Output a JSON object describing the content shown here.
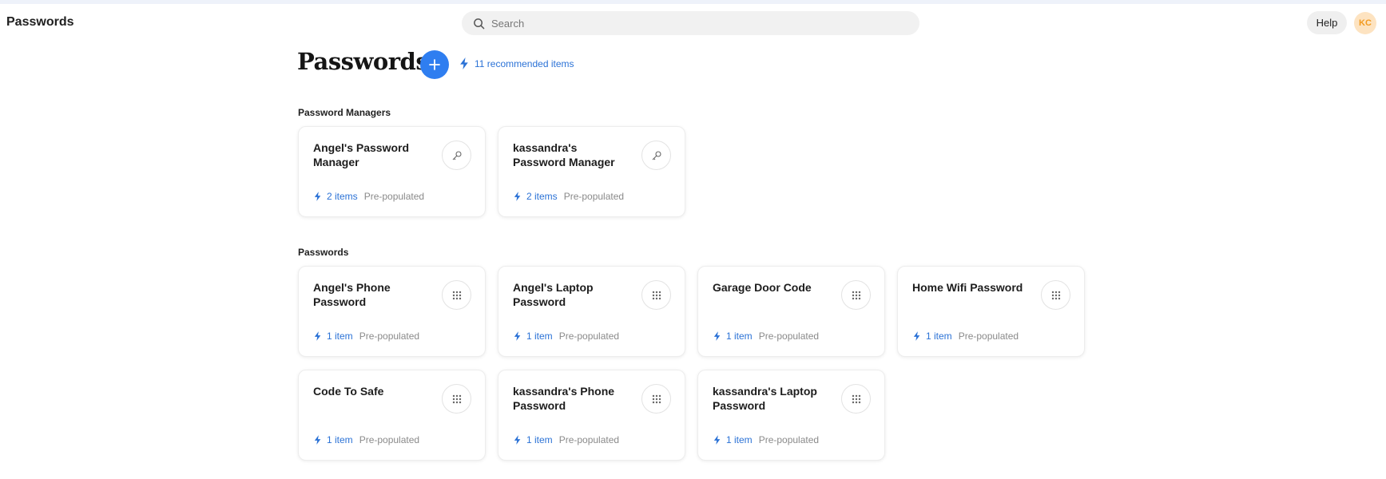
{
  "header": {
    "app_title": "Passwords",
    "search_placeholder": "Search",
    "help_label": "Help",
    "avatar_initials": "KC"
  },
  "page": {
    "title": "Passwords",
    "recommended_label": "11 recommended items"
  },
  "sections": {
    "managers": {
      "label": "Password Managers",
      "cards": [
        {
          "title": "Angel's Password Manager",
          "count": "2 items",
          "status": "Pre-populated",
          "icon": "key-icon"
        },
        {
          "title": "kassandra's Password Manager",
          "count": "2 items",
          "status": "Pre-populated",
          "icon": "key-icon"
        }
      ]
    },
    "passwords": {
      "label": "Passwords",
      "cards": [
        {
          "title": "Angel's Phone Password",
          "count": "1 item",
          "status": "Pre-populated",
          "icon": "keypad-icon"
        },
        {
          "title": "Angel's Laptop Password",
          "count": "1 item",
          "status": "Pre-populated",
          "icon": "keypad-icon"
        },
        {
          "title": "Garage Door Code",
          "count": "1 item",
          "status": "Pre-populated",
          "icon": "keypad-icon"
        },
        {
          "title": "Home Wifi Password",
          "count": "1 item",
          "status": "Pre-populated",
          "icon": "keypad-icon"
        },
        {
          "title": "Code To Safe",
          "count": "1 item",
          "status": "Pre-populated",
          "icon": "keypad-icon"
        },
        {
          "title": "kassandra's Phone Password",
          "count": "1 item",
          "status": "Pre-populated",
          "icon": "keypad-icon"
        },
        {
          "title": "kassandra's Laptop Password",
          "count": "1 item",
          "status": "Pre-populated",
          "icon": "keypad-icon"
        }
      ]
    }
  },
  "colors": {
    "accent": "#2f7ef0",
    "link": "#2b72d6",
    "avatar_bg": "#fde3c1",
    "avatar_text": "#f29a1f"
  }
}
